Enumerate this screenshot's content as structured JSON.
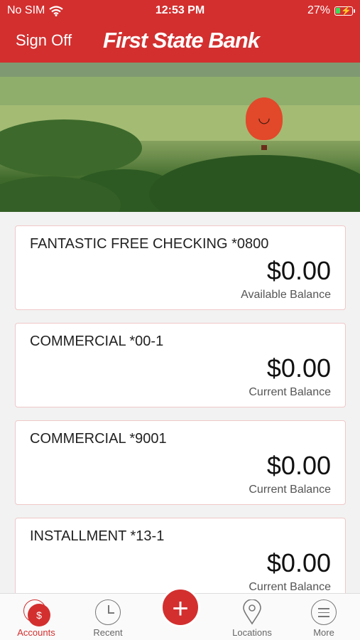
{
  "status_bar": {
    "carrier": "No SIM",
    "time": "12:53 PM",
    "battery": "27%",
    "battery_level": 0.27
  },
  "header": {
    "sign_off": "Sign Off",
    "title": "First State Bank"
  },
  "accounts": [
    {
      "name": "FANTASTIC FREE CHECKING *0800",
      "amount": "$0.00",
      "label": "Available Balance"
    },
    {
      "name": "COMMERCIAL *00-1",
      "amount": "$0.00",
      "label": "Current Balance"
    },
    {
      "name": "COMMERCIAL *9001",
      "amount": "$0.00",
      "label": "Current Balance"
    },
    {
      "name": "INSTALLMENT *13-1",
      "amount": "$0.00",
      "label": "Current Balance"
    }
  ],
  "tabbar": {
    "accounts": "Accounts",
    "recent": "Recent",
    "add": "+",
    "locations": "Locations",
    "more": "More",
    "accounts_icon_glyph": "$"
  },
  "colors": {
    "brand_red": "#d32f2f",
    "battery_green": "#3ddc5a"
  }
}
